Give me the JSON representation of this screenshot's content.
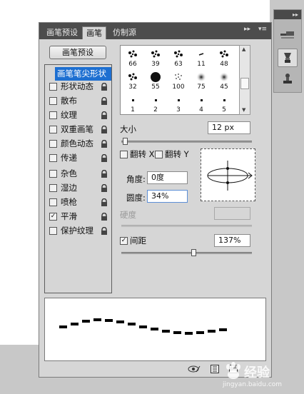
{
  "tabs": [
    {
      "label": "画笔预设",
      "active": false
    },
    {
      "label": "画笔",
      "active": true
    },
    {
      "label": "仿制源",
      "active": false
    }
  ],
  "tab_controls": {
    "collapse": "▸▸",
    "menu": "▾≡"
  },
  "dock_header": "▸▸",
  "preset_button": "画笔预设",
  "options": {
    "header": "画笔笔尖形状",
    "items": [
      {
        "label": "形状动态",
        "checked": false,
        "locked": true
      },
      {
        "label": "散布",
        "checked": false,
        "locked": true
      },
      {
        "label": "纹理",
        "checked": false,
        "locked": true
      },
      {
        "label": "双重画笔",
        "checked": false,
        "locked": true
      },
      {
        "label": "颜色动态",
        "checked": false,
        "locked": true
      },
      {
        "label": "传递",
        "checked": false,
        "locked": true
      },
      {
        "label": "杂色",
        "checked": false,
        "locked": true
      },
      {
        "label": "湿边",
        "checked": false,
        "locked": true
      },
      {
        "label": "喷枪",
        "checked": false,
        "locked": true
      },
      {
        "label": "平滑",
        "checked": true,
        "locked": true
      },
      {
        "label": "保护纹理",
        "checked": false,
        "locked": true
      }
    ]
  },
  "brushes": [
    {
      "size": "66",
      "kind": "splatter"
    },
    {
      "size": "39",
      "kind": "splatter"
    },
    {
      "size": "63",
      "kind": "splatter"
    },
    {
      "size": "11",
      "kind": "dash"
    },
    {
      "size": "48",
      "kind": "splatter"
    },
    {
      "size": "32",
      "kind": "splatter"
    },
    {
      "size": "55",
      "kind": "hard"
    },
    {
      "size": "100",
      "kind": "spray"
    },
    {
      "size": "75",
      "kind": "soft"
    },
    {
      "size": "45",
      "kind": "soft"
    },
    {
      "size": "1",
      "kind": "dot"
    },
    {
      "size": "2",
      "kind": "dot"
    },
    {
      "size": "3",
      "kind": "dot"
    },
    {
      "size": "4",
      "kind": "dot"
    },
    {
      "size": "5",
      "kind": "dot"
    }
  ],
  "size": {
    "label": "大小",
    "value": "12 px",
    "slider_percent": 3
  },
  "flip_x": {
    "label": "翻转 X",
    "checked": false
  },
  "flip_y": {
    "label": "翻转 Y",
    "checked": false
  },
  "angle": {
    "label": "角度:",
    "value": "0度"
  },
  "roundness": {
    "label": "圆度:",
    "value": "34%"
  },
  "hardness": {
    "label": "硬度",
    "value": ""
  },
  "spacing": {
    "label": "间距",
    "checked": true,
    "value": "137%",
    "slider_percent": 55
  },
  "watermark": {
    "text": "经验",
    "brand": "Baidu",
    "url": "jingyan.baidu.com"
  }
}
